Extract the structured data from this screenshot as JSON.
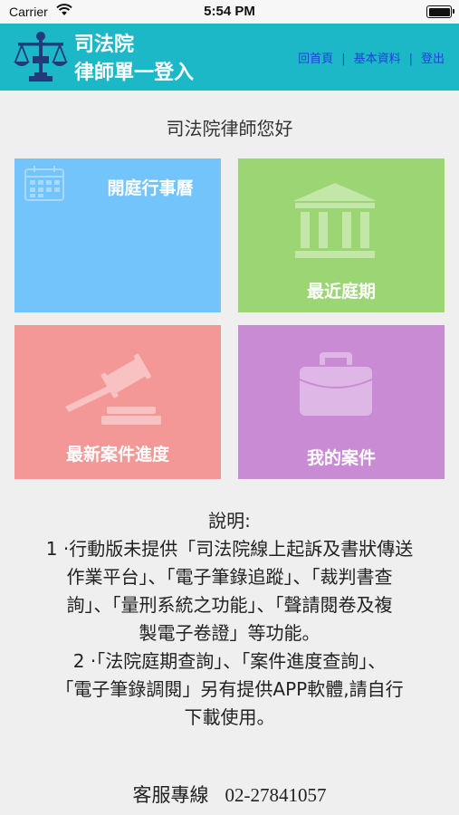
{
  "status": {
    "carrier": "Carrier",
    "time": "5:54 PM"
  },
  "header": {
    "title_line1": "司法院",
    "title_line2": "律師單一登入",
    "nav": {
      "home": "回首頁",
      "profile": "基本資料",
      "logout": "登出"
    }
  },
  "greeting": "司法院律師您好",
  "tiles": [
    {
      "label": "開庭行事曆",
      "icon": "calendar-icon",
      "color": "#74c4fc"
    },
    {
      "label": "最近庭期",
      "icon": "courthouse-icon",
      "color": "#9bd574"
    },
    {
      "label": "最新案件進度",
      "icon": "gavel-icon",
      "color": "#f49797"
    },
    {
      "label": "我的案件",
      "icon": "briefcase-icon",
      "color": "#c98cd4"
    }
  ],
  "description": {
    "heading": "說明:",
    "item1_line1": "1 ·行動版未提供「司法院線上起訴及書狀傳送",
    "item1_line2": "作業平台」、「電子筆錄追蹤」、「裁判書查",
    "item1_line3": "詢」、「量刑系統之功能」、「聲請閱卷及複",
    "item1_line4": "製電子卷證」等功能。",
    "item2_line1": "2 ·「法院庭期查詢」、「案件進度查詢」、",
    "item2_line2": "「電子筆錄調閱」另有提供APP軟體,請自行",
    "item2_line3": "下載使用。"
  },
  "hotline": {
    "label": "客服專線",
    "number": "02-27841057"
  },
  "colors": {
    "header": "#1cb8c7",
    "nav_link": "#1a44d6"
  }
}
